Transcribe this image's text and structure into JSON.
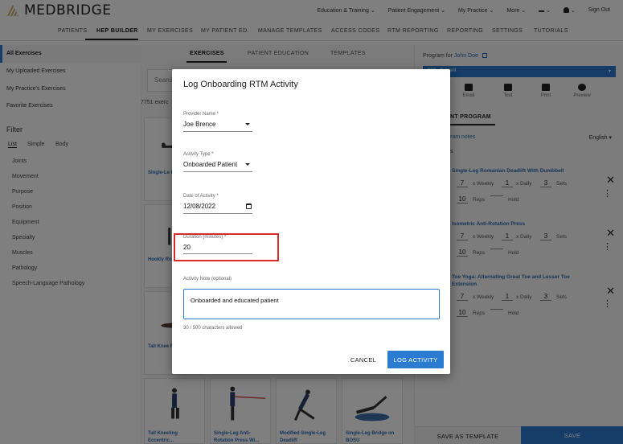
{
  "brand": {
    "name": "MEDBRIDGE"
  },
  "top_menu": [
    "Education & Training ⌄",
    "Patient Engagement ⌄",
    "My Practice ⌄",
    "More ⌄",
    "▬ ⌄",
    "⌄",
    "Sign Out"
  ],
  "nav": [
    "PATIENTS",
    "HEP BUILDER",
    "MY EXERCISES",
    "MY PATIENT ED.",
    "MANAGE TEMPLATES",
    "ACCESS CODES",
    "RTM REPORTING",
    "REPORTING",
    "SETTINGS",
    "TUTORIALS"
  ],
  "sidebar": {
    "items": [
      "All Exercises",
      "My Uploaded Exercises",
      "My Practice's Exercises",
      "Favorite Exercises"
    ],
    "filter_title": "Filter",
    "filter_tabs": [
      "List",
      "Simple",
      "Body"
    ],
    "filters": [
      "Joints",
      "Movement",
      "Purpose",
      "Position",
      "Equipment",
      "Specialty",
      "Muscles",
      "Pathology",
      "Speech-Language Pathology"
    ]
  },
  "center": {
    "tabs": [
      "EXERCISES",
      "PATIENT EDUCATION",
      "TEMPLATES"
    ],
    "search_placeholder": "Search",
    "count": "7751 exerc",
    "cards": [
      "Single-Le Romanian",
      "Hookly Rotation",
      "Tall Knee Rotation",
      "Tall Kneeling Eccentric...",
      "Single-Leg Anti-Rotation Press Wi...",
      "Modified Single-Leg Deadlift",
      "Single-Leg Bridge on BOSU"
    ]
  },
  "right_panel": {
    "program_for_label": "Program for",
    "patient_name": "John Doe",
    "program_select": "022 - Current",
    "share": [
      "Email",
      "Text",
      "Print",
      "Preview"
    ],
    "tab": "NT PROGRAM",
    "notes": "ram notes",
    "language": "English ▾",
    "section": "s",
    "exercises": [
      {
        "title": "Single-Leg Romanian Deadlift With Dumbbell",
        "weekly": "7",
        "daily": "1",
        "sets": "3",
        "reps": "10"
      },
      {
        "title": "Isometric Anti-Rotation Press",
        "weekly": "7",
        "daily": "1",
        "sets": "3",
        "reps": "10"
      },
      {
        "title": "Toe Yoga: Alternating Great Toe and Lesser Toe Extension",
        "weekly": "7",
        "daily": "1",
        "sets": "3",
        "reps": "10"
      }
    ],
    "labels": {
      "weekly": "x Weekly",
      "daily": "x Daily",
      "sets": "Sets",
      "reps": "Reps",
      "hold": "Hold"
    },
    "save_template": "SAVE AS TEMPLATE",
    "save": "SAVE"
  },
  "modal": {
    "title": "Log Onboarding RTM Activity",
    "provider_label": "Provider Name *",
    "provider_value": "Joe Brence",
    "activity_label": "Activity Type *",
    "activity_value": "Onboarded Patient",
    "date_label": "Date of Activity *",
    "date_value": "12/08/2022",
    "duration_label": "Duration (minutes) *",
    "duration_value": "20",
    "note_label": "Activity Note (optional)",
    "note_value": "Onboarded and educated patient",
    "char_count": "30 / 500 characters allowed",
    "cancel": "CANCEL",
    "submit": "LOG ACTIVITY"
  }
}
